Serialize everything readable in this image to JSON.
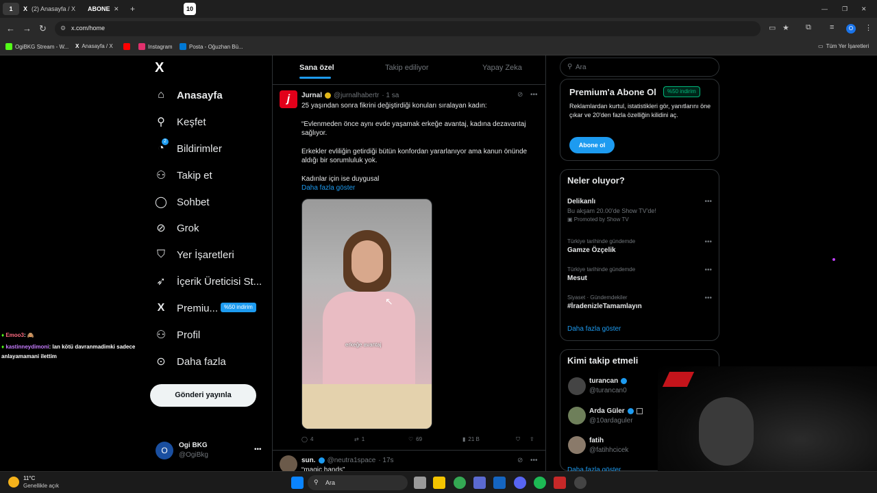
{
  "browser": {
    "tabs": [
      {
        "label": "(2) Anasayfa / X"
      },
      {
        "label": "ABONE"
      }
    ],
    "tab_count_badge": "10",
    "new_tab": "+",
    "address": "x.com/home",
    "bookmarks": [
      {
        "label": "OgiBKG Stream - W...",
        "color": "#53fc18"
      },
      {
        "label": "Anasayfa / X",
        "color": "#ffffff"
      },
      {
        "label": "",
        "color": "#ff0000"
      },
      {
        "label": "Instagram",
        "color": "#e1306c"
      },
      {
        "label": "Posta - Oğuzhan Bü...",
        "color": "#0078d4"
      }
    ],
    "all_bookmarks": "Tüm Yer İşaretleri",
    "profile_initial": "O"
  },
  "sidebar": {
    "logo": "X",
    "items": [
      {
        "label": "Anasayfa",
        "icon": "home-icon",
        "glyph": "⌂"
      },
      {
        "label": "Keşfet",
        "icon": "search-icon",
        "glyph": "⚲"
      },
      {
        "label": "Bildirimler",
        "icon": "bell-icon",
        "glyph": "🔔",
        "badge": "2"
      },
      {
        "label": "Takip et",
        "icon": "follow-icon",
        "glyph": "👤"
      },
      {
        "label": "Sohbet",
        "icon": "chat-icon",
        "glyph": "💬"
      },
      {
        "label": "Grok",
        "icon": "grok-icon",
        "glyph": "⊘"
      },
      {
        "label": "Yer İşaretleri",
        "icon": "bookmark-icon",
        "glyph": "🔖"
      },
      {
        "label": "İçerik Üreticisi St...",
        "icon": "rocket-icon",
        "glyph": "🚀"
      },
      {
        "label": "Premiu...",
        "icon": "x-premium-icon",
        "glyph": "X",
        "badge": "%50 indirim"
      },
      {
        "label": "Profil",
        "icon": "profile-icon",
        "glyph": "👤"
      },
      {
        "label": "Daha fazla",
        "icon": "more-icon",
        "glyph": "⋯"
      }
    ],
    "post_button": "Gönderi yayınla",
    "account": {
      "name": "Ogi BKG",
      "handle": "@OgiBkg",
      "initial": "O"
    }
  },
  "center": {
    "tabs": [
      "Sana özel",
      "Takip ediliyor",
      "Yapay Zeka"
    ],
    "tweet": {
      "author": "Jurnal",
      "handle": "@jurnalhabertr",
      "time": "· 1 sa",
      "avatar_letter": "j",
      "lines": [
        "25 yaşından sonra fikrini değiştirdiği konuları sıralayan kadın:",
        "“Evlenmeden önce aynı evde yaşamak erkeğe avantaj, kadına dezavantaj sağlıyor.",
        "Erkekler evliliğin getirdiği bütün konfordan yararlanıyor ama kanun önünde aldığı bir sorumluluk yok.",
        "Kadınlar için ise duygusal"
      ],
      "show_more": "Daha fazla göster",
      "video_caption": "erkeğe avantaj",
      "actions": {
        "replies": "4",
        "reposts": "1",
        "likes": "69",
        "views": "21 B"
      }
    },
    "next_tweet": {
      "author": "sun.",
      "handle": "@neutra1space",
      "time": "· 17s",
      "text": "“magic hands”"
    }
  },
  "right": {
    "search_placeholder": "Ara",
    "premium": {
      "title": "Premium'a Abone Ol",
      "badge": "%50 indirim",
      "body": "Reklamlardan kurtul, istatistikleri gör, yanıtlarını öne çıkar ve 20'den fazla özelliğin kilidini aç.",
      "button": "Abone ol"
    },
    "trends": {
      "title": "Neler oluyor?",
      "items": [
        {
          "category": "",
          "name": "Delikanlı",
          "sub": "Bu akşam 20.00'de Show TV'de!",
          "promo": "Promoted by Show TV"
        },
        {
          "category": "Türkiye tarihinde gündemde",
          "name": "Gamze Özçelik"
        },
        {
          "category": "Türkiye tarihinde gündemde",
          "name": "Mesut"
        },
        {
          "category": "Siyaset · Gündemdekiler",
          "name": "#İradenizleTamamlayın"
        }
      ],
      "show_more": "Daha fazla göster"
    },
    "who_to_follow": {
      "title": "Kimi takip etmeli",
      "users": [
        {
          "name": "turancan",
          "handle": "@turancan0"
        },
        {
          "name": "Arda Güler",
          "handle": "@10ardaguler"
        },
        {
          "name": "fatih",
          "handle": "@fatihhcicek"
        }
      ],
      "show_more": "Daha fazla göster"
    }
  },
  "chat_overlay": [
    {
      "user": "Emoo3",
      "text": ": 🙈"
    },
    {
      "user": "kastinneydimoni",
      "text": ": lan kötü davranmadimki sadece anlayamamani ilettim"
    }
  ],
  "taskbar": {
    "weather_temp": "11°C",
    "weather_desc": "Genellikle açık",
    "search": "Ara"
  },
  "colors": {
    "accent": "#1d9bf0",
    "premium_green": "#00ba7c",
    "bg": "#000000"
  }
}
